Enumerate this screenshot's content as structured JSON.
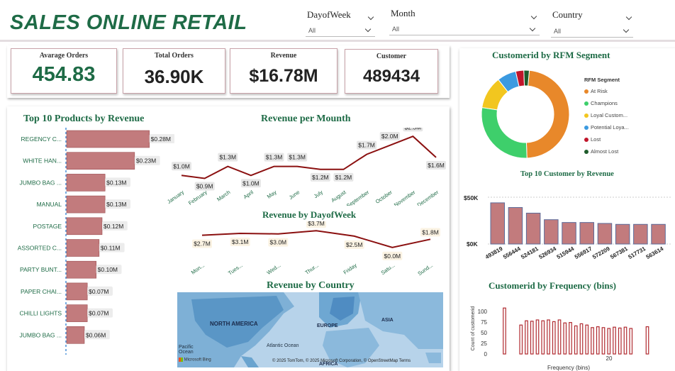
{
  "header": {
    "title": "SALES ONLINE RETAIL"
  },
  "slicers": [
    {
      "label": "DayofWeek",
      "value": "All"
    },
    {
      "label": "Month",
      "value": "All"
    },
    {
      "label": "Country",
      "value": "All"
    }
  ],
  "kpis": [
    {
      "title": "Avarage Orders",
      "value": "454.83"
    },
    {
      "title": "Total Orders",
      "value": "36.90K"
    },
    {
      "title": "Revenue",
      "value": "$16.78M"
    },
    {
      "title": "Customer",
      "value": "489434"
    }
  ],
  "colors": {
    "accent_green": "#1e6b46",
    "bar_fill": "#c27b7d",
    "line": "#8b1010",
    "pie_at_risk": "#e8882a",
    "pie_champions": "#3ecf6b",
    "pie_loyal": "#f2c61f",
    "pie_potential": "#3b9ae0",
    "pie_lost": "#c0152a",
    "pie_almost_lost": "#1f5c2c"
  },
  "products_chart": {
    "title": "Top 10 Products by Revenue"
  },
  "monthly_chart": {
    "title": "Revenue per Mounth"
  },
  "dow_chart": {
    "title": "Revenue by DayofWeek"
  },
  "map": {
    "title": "Revenue by Country",
    "labels": [
      "NORTH AMERICA",
      "EUROPE",
      "ASIA",
      "Atlantic Ocean",
      "Pacific Ocean",
      "AFRICA"
    ],
    "attribution": "© 2025 TomTom, © 2025 Microsoft Corporation, © OpenStreetMap  Terms",
    "brand": "Microsoft Bing"
  },
  "rfm_chart": {
    "title": "Customerid by RFM Segment",
    "legend_title": "RFM Segment"
  },
  "customers_chart": {
    "title": "Top 10 Customer by Revenue"
  },
  "freq_chart": {
    "title": "Customerid by Frequency (bins)",
    "xlabel": "Frequency (bins)",
    "ylabel": "Count of customerid"
  },
  "chart_data": [
    {
      "type": "bar",
      "orientation": "horizontal",
      "title": "Top 10 Products by Revenue",
      "categories": [
        "REGENCY C...",
        "WHITE HAN...",
        "JUMBO BAG ...",
        "MANUAL",
        "POSTAGE",
        "ASSORTED C...",
        "PARTY BUNT...",
        "PAPER CHAI...",
        "CHILLI LIGHTS",
        "JUMBO BAG ..."
      ],
      "values": [
        0.28,
        0.23,
        0.13,
        0.13,
        0.12,
        0.11,
        0.1,
        0.07,
        0.07,
        0.06
      ],
      "labels": [
        "$0.28M",
        "$0.23M",
        "$0.13M",
        "$0.13M",
        "$0.12M",
        "$0.11M",
        "$0.10M",
        "$0.07M",
        "$0.07M",
        "$0.06M"
      ],
      "xlim": [
        0,
        0.3
      ]
    },
    {
      "type": "line",
      "title": "Revenue per Mounth",
      "categories": [
        "January",
        "February",
        "March",
        "April",
        "May",
        "June",
        "July",
        "August",
        "September",
        "October",
        "November",
        "December"
      ],
      "values": [
        1.0,
        0.9,
        1.3,
        1.0,
        1.3,
        1.3,
        1.2,
        1.2,
        1.7,
        2.0,
        2.3,
        1.6
      ],
      "labels": [
        "$1.0M",
        "$0.9M",
        "$1.3M",
        "$1.0M",
        "$1.3M",
        "$1.3M",
        "$1.2M",
        "$1.2M",
        "$1.7M",
        "$2.0M",
        "$2.3M",
        "$1.6M"
      ],
      "ylim": [
        0.7,
        2.4
      ]
    },
    {
      "type": "line",
      "title": "Revenue by DayofWeek",
      "categories": [
        "Mon...",
        "Tues...",
        "Wed...",
        "Thur...",
        "Friday",
        "Satu...",
        "Sund..."
      ],
      "values": [
        2.7,
        3.1,
        3.0,
        3.7,
        2.5,
        0.0,
        1.8
      ],
      "labels": [
        "$2.7M",
        "$3.1M",
        "$3.0M",
        "$3.7M",
        "$2.5M",
        "$0.0M",
        "$1.8M"
      ],
      "ylim": [
        -0.5,
        4.2
      ]
    },
    {
      "type": "pie",
      "donut": true,
      "title": "Customerid by RFM Segment",
      "categories": [
        "At Risk",
        "Champions",
        "Loyal Custom...",
        "Potential Loya...",
        "Lost",
        "Almost Lost"
      ],
      "values": [
        48,
        28,
        12,
        7,
        3,
        2
      ]
    },
    {
      "type": "bar",
      "title": "Top 10 Customer by Revenue",
      "categories": [
        "493819",
        "556444",
        "524181",
        "526934",
        "515944",
        "556917",
        "572209",
        "567381",
        "517731",
        "563614"
      ],
      "values": [
        44,
        39,
        33,
        26,
        23,
        23,
        22,
        21,
        21,
        21
      ],
      "ylim": [
        0,
        50
      ],
      "yticks": [
        "$0K",
        "$50K"
      ]
    },
    {
      "type": "bar",
      "title": "Customerid by Frequency (bins)",
      "xlabel": "Frequency (bins)",
      "ylabel": "Count of customerid",
      "x": [
        1,
        4,
        5,
        6,
        7,
        8,
        9,
        10,
        11,
        12,
        13,
        14,
        15,
        16,
        17,
        18,
        19,
        20,
        21,
        22,
        23,
        24,
        27
      ],
      "values": [
        108,
        68,
        78,
        77,
        80,
        78,
        80,
        76,
        80,
        73,
        74,
        66,
        71,
        68,
        62,
        64,
        62,
        60,
        63,
        61,
        63,
        60,
        64
      ],
      "ylim": [
        0,
        120
      ],
      "yticks": [
        0,
        25,
        50,
        75,
        100
      ],
      "xticks": [
        20
      ]
    }
  ]
}
